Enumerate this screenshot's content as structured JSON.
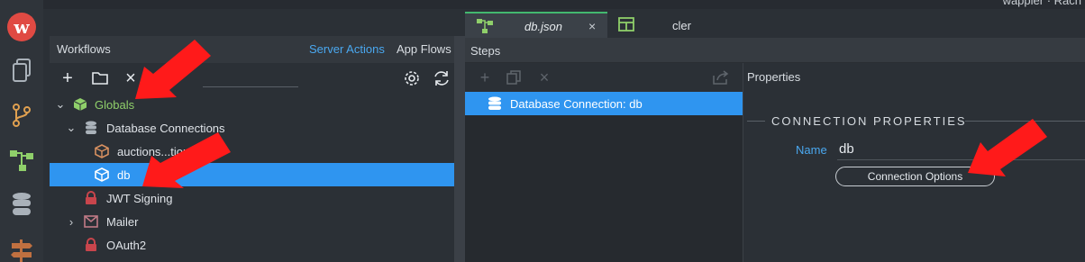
{
  "top_bar": {
    "user_text": "wappler · Rach"
  },
  "rail": {
    "logo_letter": "w",
    "icons": [
      "pages-icon",
      "git-branch-icon",
      "workflows-icon",
      "database-icon",
      "signpost-icon"
    ]
  },
  "workflows": {
    "title": "Workflows",
    "tabs": {
      "server_actions": "Server Actions",
      "app_flows": "App Flows"
    },
    "toolbar": {
      "add": "+",
      "folder": "folder-icon",
      "close": "×",
      "settings": "gear-icon",
      "refresh": "refresh-icon"
    },
    "search_value": "",
    "tree": [
      {
        "label": "Globals",
        "level": 0,
        "expanded": true,
        "icon": "cube-icon",
        "color": "#8fcf6a"
      },
      {
        "label": "Database Connections",
        "level": 1,
        "expanded": true,
        "icon": "database-icon",
        "color": "#aab2ba"
      },
      {
        "label": "auctions...tion",
        "level": 2,
        "icon": "cube-icon",
        "color": "#d89060"
      },
      {
        "label": "db",
        "level": 2,
        "icon": "cube-icon",
        "color": "#ffffff",
        "selected": true
      },
      {
        "label": "JWT Signing",
        "level": 1,
        "icon": "lock-icon",
        "color": "#c8454c"
      },
      {
        "label": "Mailer",
        "level": 1,
        "expandable": true,
        "icon": "mail-icon",
        "color": "#c07a86"
      },
      {
        "label": "OAuth2",
        "level": 1,
        "icon": "lock-icon",
        "color": "#c8454c"
      }
    ]
  },
  "editor": {
    "tabs": [
      {
        "label": "db.json",
        "active": true,
        "close": "×"
      },
      {
        "label": "cler",
        "active": false
      }
    ],
    "steps": {
      "title": "Steps",
      "items": [
        {
          "label": "Database Connection: db",
          "selected": true
        }
      ]
    },
    "properties": {
      "title": "Properties",
      "section": "CONNECTION PROPERTIES",
      "name_label": "Name",
      "name_value": "db",
      "connection_options": "Connection Options"
    }
  },
  "colors": {
    "accent": "#2f95f0",
    "link": "#4aa8f0",
    "arrow": "#ff1a1a",
    "tab_active": "#43b86f"
  }
}
